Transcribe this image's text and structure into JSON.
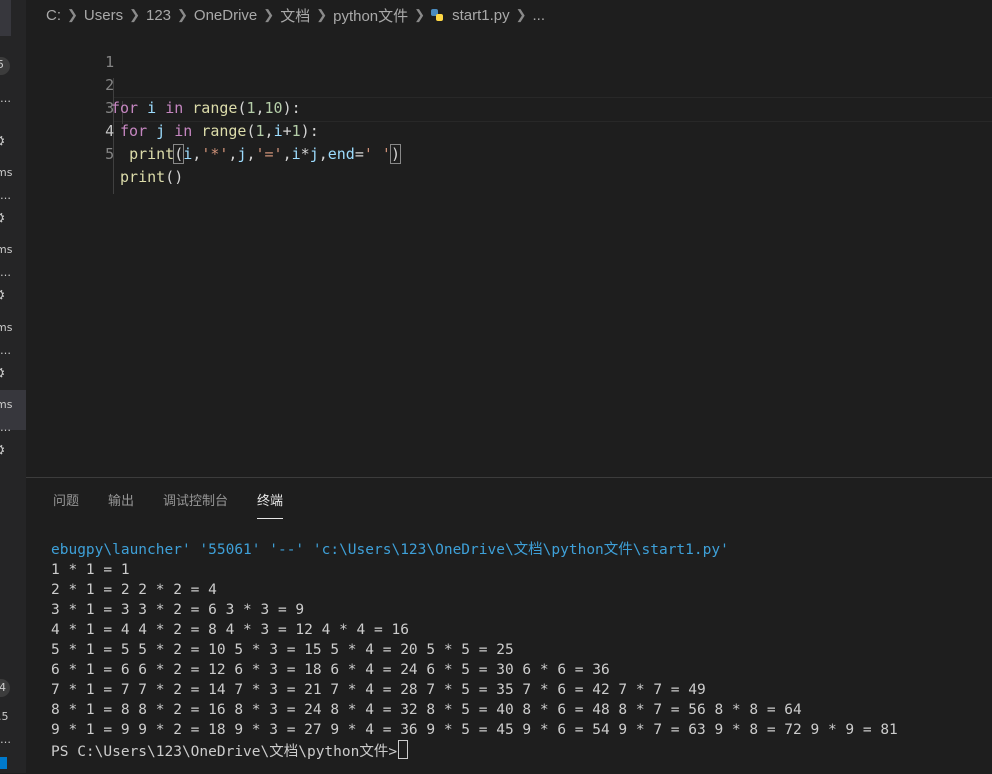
{
  "sidebar": {
    "badge": "5",
    "labels": [
      "…",
      "ms",
      "…",
      "ms",
      "…",
      "ms",
      "…",
      "ms",
      "…",
      "4",
      ".5",
      "…"
    ]
  },
  "breadcrumb": {
    "items": [
      "C:",
      "Users",
      "123",
      "OneDrive",
      "文档",
      "python文件",
      "start1.py",
      "..."
    ]
  },
  "editor": {
    "language_icon": "python-file-icon",
    "active_line": 4,
    "line_numbers": [
      "1",
      "2",
      "3",
      "4",
      "5"
    ],
    "lines": [
      "",
      "for i in range(1,10):",
      " for j in range(1,i+1):",
      "  print(i,'*',j,'=',i*j,end=' ')",
      " print()"
    ]
  },
  "panel": {
    "tabs": [
      "问题",
      "输出",
      "调试控制台",
      "终端"
    ],
    "active_tab": "终端",
    "terminal": {
      "command_line": "ebugpy\\launcher' '55061' '--' 'c:\\Users\\123\\OneDrive\\文档\\python文件\\start1.py'",
      "output": [
        "1 * 1 = 1",
        "2 * 1 = 2 2 * 2 = 4",
        "3 * 1 = 3 3 * 2 = 6 3 * 3 = 9",
        "4 * 1 = 4 4 * 2 = 8 4 * 3 = 12 4 * 4 = 16",
        "5 * 1 = 5 5 * 2 = 10 5 * 3 = 15 5 * 4 = 20 5 * 5 = 25",
        "6 * 1 = 6 6 * 2 = 12 6 * 3 = 18 6 * 4 = 24 6 * 5 = 30 6 * 6 = 36",
        "7 * 1 = 7 7 * 2 = 14 7 * 3 = 21 7 * 4 = 28 7 * 5 = 35 7 * 6 = 42 7 * 7 = 49",
        "8 * 1 = 8 8 * 2 = 16 8 * 3 = 24 8 * 4 = 32 8 * 5 = 40 8 * 6 = 48 8 * 7 = 56 8 * 8 = 64",
        "9 * 1 = 9 9 * 2 = 18 9 * 3 = 27 9 * 4 = 36 9 * 5 = 45 9 * 6 = 54 9 * 7 = 63 9 * 8 = 72 9 * 9 = 81"
      ],
      "prompt": "PS C:\\Users\\123\\OneDrive\\文档\\python文件>"
    }
  },
  "colors": {
    "background": "#1e1e1e",
    "keyword": "#c586c0",
    "function": "#dcdcaa",
    "string": "#ce9178",
    "number": "#b5cea8",
    "terminal_command": "#3ea0d8"
  }
}
